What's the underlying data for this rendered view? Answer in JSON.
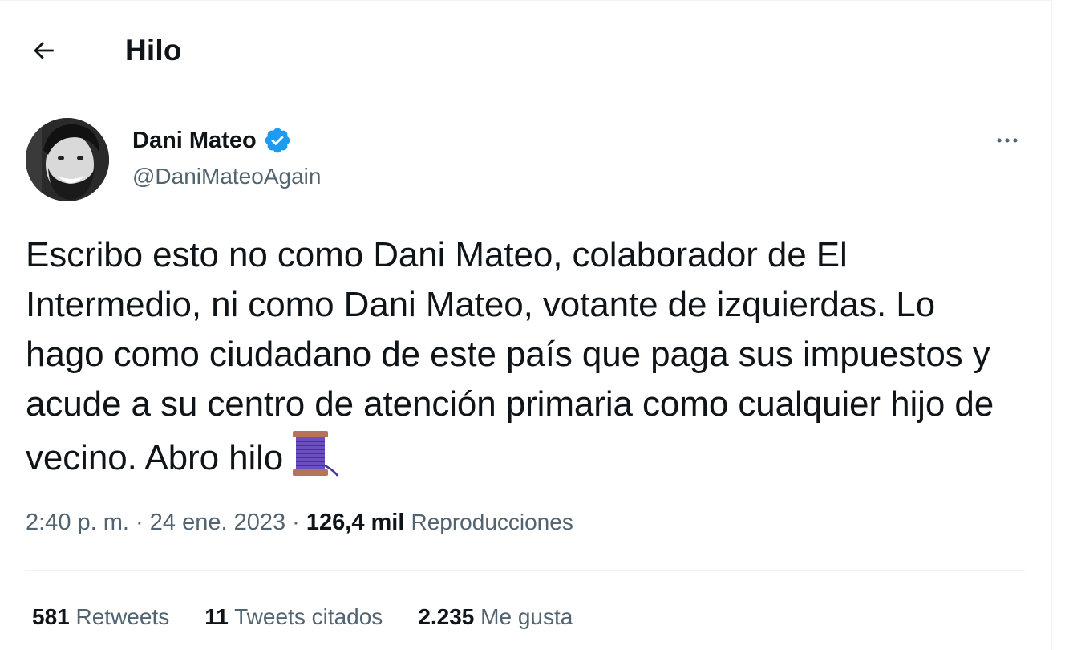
{
  "header": {
    "title": "Hilo",
    "back_icon": "arrow-left-icon"
  },
  "author": {
    "name": "Dani Mateo",
    "handle": "@DaniMateoAgain",
    "verified": true,
    "verified_color": "#1d9bf0",
    "avatar_icon": "profile-photo"
  },
  "tweet": {
    "text": "Escribo esto no como Dani Mateo, colaborador de El Intermedio, ni como Dani Mateo, votante de izquierdas. Lo hago como ciudadano de este país que paga sus impuestos y acude a su centro de atención primaria como cualquier hijo de vecino. Abro hilo",
    "emoji_icon": "thread-spool-emoji"
  },
  "meta": {
    "time": "2:40 p. m.",
    "separator": "·",
    "date": "24 ene. 2023",
    "views_count": "126,4 mil",
    "views_label": "Reproducciones"
  },
  "stats": [
    {
      "count": "581",
      "label": "Retweets"
    },
    {
      "count": "11",
      "label": "Tweets citados"
    },
    {
      "count": "2.235",
      "label": "Me gusta"
    }
  ],
  "colors": {
    "text_primary": "#0f1419",
    "text_secondary": "#536471",
    "divider": "#eff3f4"
  }
}
